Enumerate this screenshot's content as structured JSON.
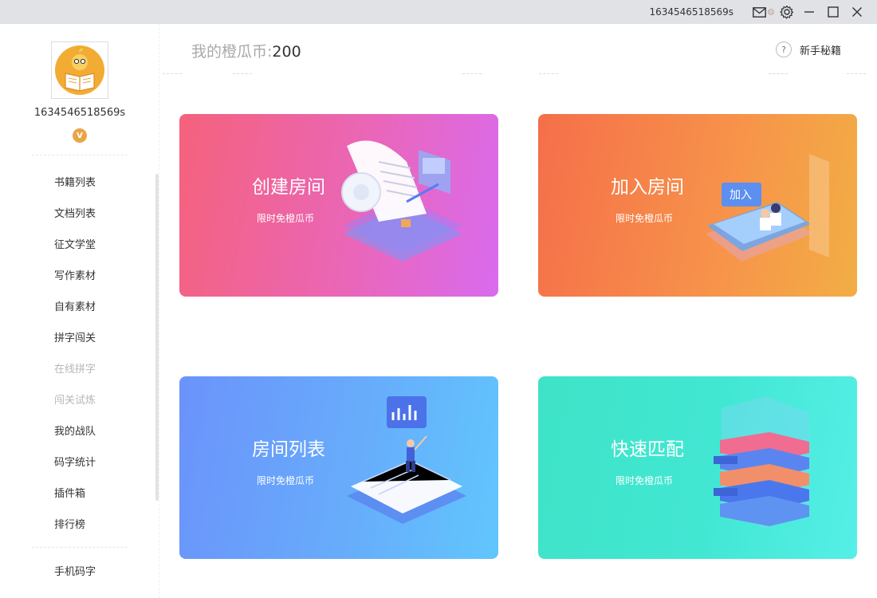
{
  "titlebar": {
    "username": "1634546518569s",
    "mail_badge": "0"
  },
  "sidebar": {
    "username": "1634546518569s",
    "vip_label": "V",
    "items": [
      {
        "label": "书籍列表",
        "enabled": true
      },
      {
        "label": "文档列表",
        "enabled": true
      },
      {
        "label": "征文学堂",
        "enabled": true
      },
      {
        "label": "写作素材",
        "enabled": true
      },
      {
        "label": "自有素材",
        "enabled": true
      },
      {
        "label": "拼字闯关",
        "enabled": true
      },
      {
        "label": "在线拼字",
        "enabled": false
      },
      {
        "label": "闯关试炼",
        "enabled": false
      },
      {
        "label": "我的战队",
        "enabled": true
      },
      {
        "label": "码字统计",
        "enabled": true
      },
      {
        "label": "插件箱",
        "enabled": true
      },
      {
        "label": "排行榜",
        "enabled": true
      }
    ],
    "bottom_item": "手机码字"
  },
  "header": {
    "coins_label": "我的橙瓜币:",
    "coins_value": "200",
    "help_icon": "?",
    "help_label": "新手秘籍"
  },
  "cards": {
    "create": {
      "title": "创建房间",
      "subtitle": "限时免橙瓜币",
      "color_start": "#f5627c",
      "color_end": "#d96bef"
    },
    "join": {
      "title": "加入房间",
      "subtitle": "限时免橙瓜币",
      "badge": "加入",
      "color_start": "#f56f4a",
      "color_end": "#f2ae45"
    },
    "list": {
      "title": "房间列表",
      "subtitle": "限时免橙瓜币",
      "color_start": "#6b93fb",
      "color_end": "#61c6fd"
    },
    "match": {
      "title": "快速匹配",
      "subtitle": "限时免橙瓜币",
      "color_start": "#3ee3c7",
      "color_end": "#55efe7"
    }
  }
}
